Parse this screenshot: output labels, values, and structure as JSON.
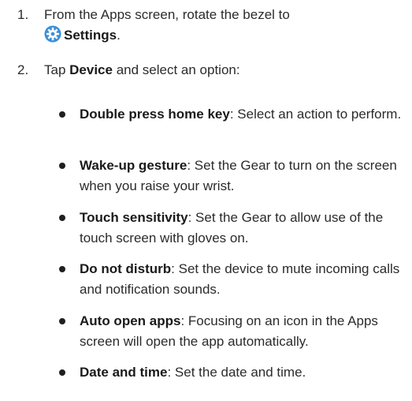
{
  "steps": [
    {
      "number": "1.",
      "text_before": "From the Apps screen, rotate the bezel to",
      "icon": "settings-gear-icon",
      "bold": "Settings",
      "text_after": "."
    },
    {
      "number": "2.",
      "text_before": "Tap ",
      "bold": "Device",
      "text_after": " and select an option:"
    }
  ],
  "options": [
    {
      "term": "Double press home key",
      "desc": ": Select an action to perform."
    },
    {
      "term": "Wake-up gesture",
      "desc": ": Set the Gear to turn on the screen when you raise your wrist."
    },
    {
      "term": "Touch sensitivity",
      "desc": ": Set the Gear to allow use of the touch screen with gloves on."
    },
    {
      "term": "Do not disturb",
      "desc": ": Set the device to mute incoming calls and notification sounds."
    },
    {
      "term": "Auto open apps",
      "desc": ": Focusing on an icon in the Apps screen will open the app automatically."
    },
    {
      "term": "Date and time",
      "desc": ": Set the date and time."
    }
  ],
  "colors": {
    "text": "#2b2b2b",
    "icon_blue": "#3b8fd9"
  }
}
